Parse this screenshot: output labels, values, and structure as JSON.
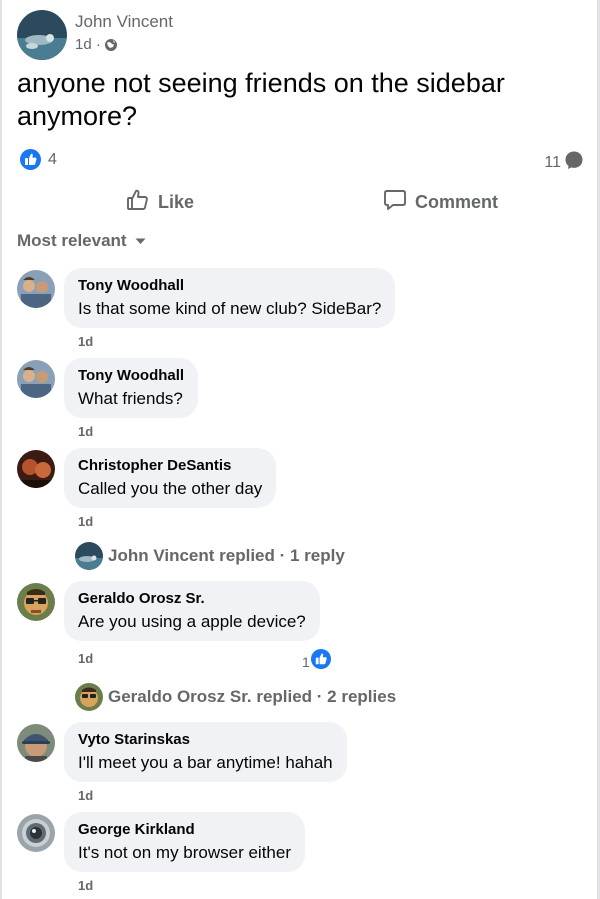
{
  "post": {
    "author": "John Vincent",
    "time": "1d ·",
    "text": "anyone not seeing friends on the sidebar anymore?",
    "like_count": "4",
    "comment_count": "11"
  },
  "actions": {
    "like_label": "Like",
    "comment_label": "Comment"
  },
  "sort": {
    "label": "Most relevant"
  },
  "comments": [
    {
      "author": "Tony Woodhall",
      "text": "Is that some kind of new club? SideBar?",
      "time": "1d"
    },
    {
      "author": "Tony Woodhall",
      "text": "What friends?",
      "time": "1d"
    },
    {
      "author": "Christopher DeSantis",
      "text": "Called you the other day",
      "time": "1d"
    },
    {
      "author": "Geraldo Orosz Sr.",
      "text": "Are you using a apple device?",
      "time": "1d",
      "likes": "1"
    },
    {
      "author": "Vyto Starinskas",
      "text": "I'll meet you a bar anytime! hahah",
      "time": "1d"
    },
    {
      "author": "George Kirkland",
      "text": "It's not on my browser either",
      "time": "1d"
    }
  ],
  "replies": [
    {
      "text": "John Vincent replied · 1 reply"
    },
    {
      "text": "Geraldo Orosz Sr. replied · 2 replies"
    }
  ],
  "colors": {
    "like_blue": "#1877f2",
    "secondary_text": "#65676b",
    "bubble_bg": "#f0f2f5"
  }
}
